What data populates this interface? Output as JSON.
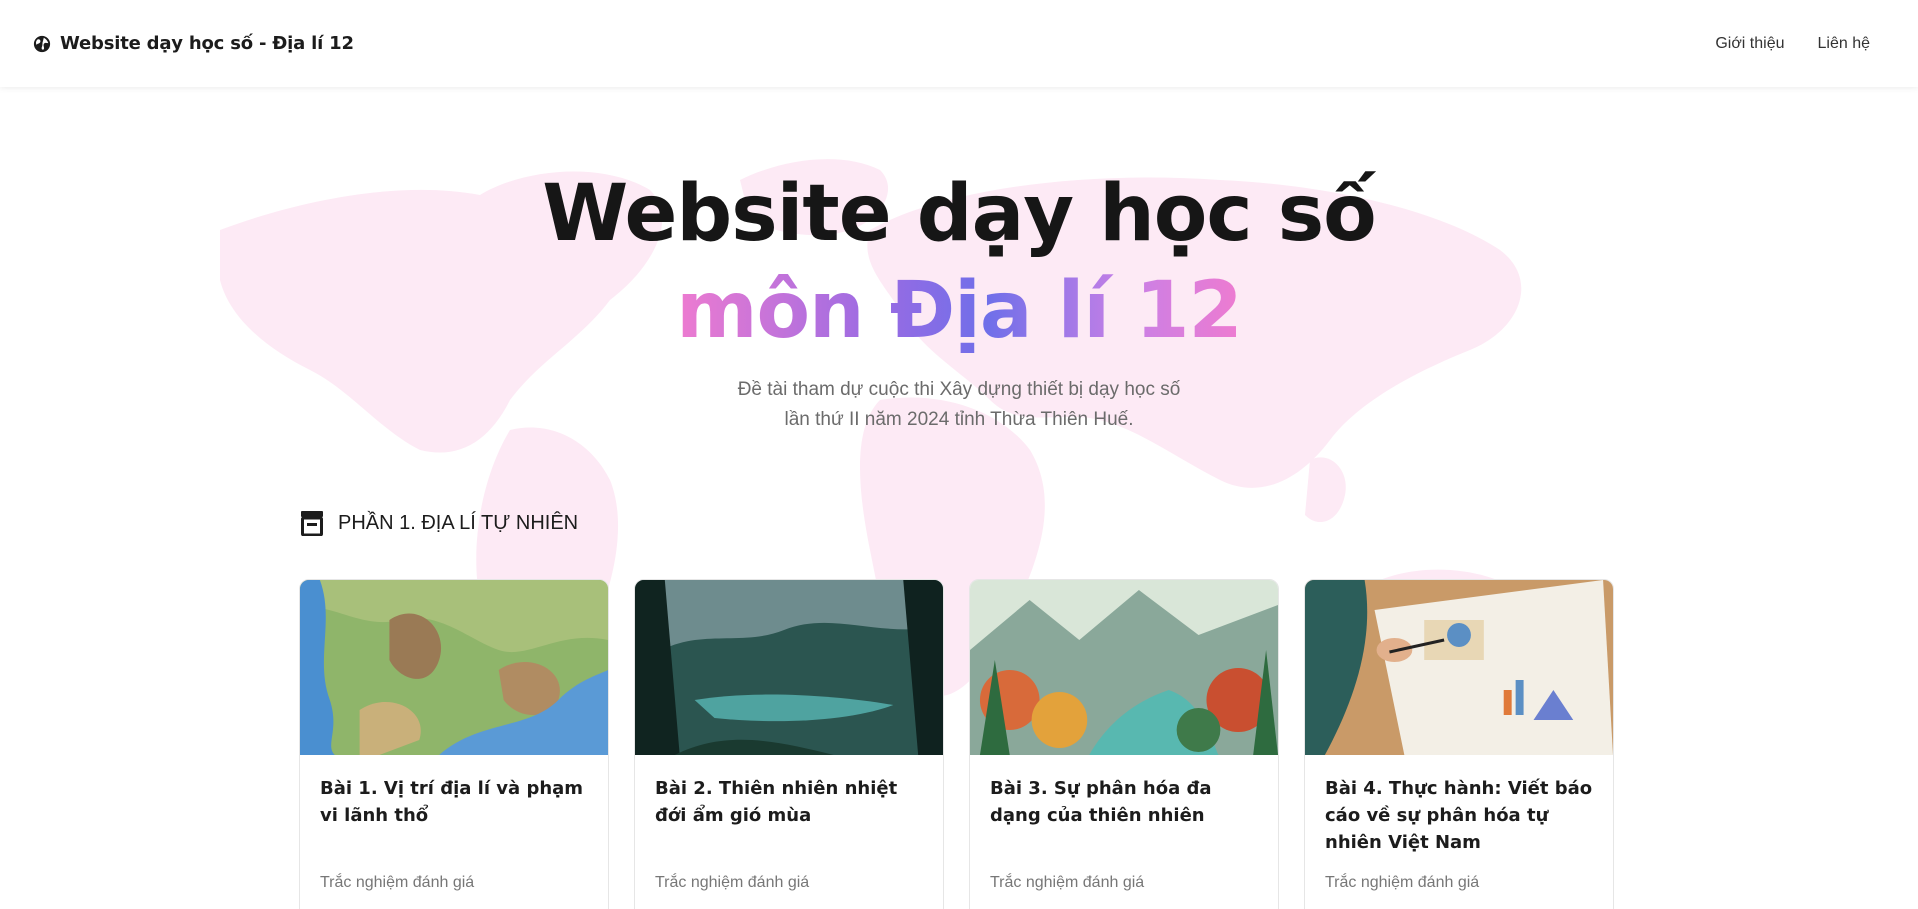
{
  "header": {
    "brand_title": "Website dạy học số - Địa lí 12",
    "nav": [
      {
        "label": "Giới thiệu"
      },
      {
        "label": "Liên hệ"
      }
    ]
  },
  "hero": {
    "line1": "Website dạy học số",
    "line2": "môn Địa lí 12",
    "subtitle_line1": "Đề tài tham dự cuộc thi Xây dựng thiết bị dạy học số",
    "subtitle_line2": "lần thứ II năm 2024 tỉnh Thừa Thiên Huế."
  },
  "section": {
    "title": "PHẦN 1. ĐỊA LÍ TỰ NHIÊN",
    "icon": "archive-box-icon"
  },
  "cards": [
    {
      "title": "Bài 1. Vị trí địa lí và phạm vi lãnh thổ",
      "link": "Trắc nghiệm đánh giá",
      "image": "topographic-map"
    },
    {
      "title": "Bài 2. Thiên nhiên nhiệt đới ẩm gió mùa",
      "link": "Trắc nghiệm đánh giá",
      "image": "tropical-rainforest-river"
    },
    {
      "title": "Bài 3. Sự phân hóa đa dạng của thiên nhiên",
      "link": "Trắc nghiệm đánh giá",
      "image": "colorful-forest-valley"
    },
    {
      "title": "Bài 4. Thực hành: Viết báo cáo về sự phân hóa tự nhiên Việt Nam",
      "link": "Trắc nghiệm đánh giá",
      "image": "person-writing-report"
    }
  ],
  "colors": {
    "gradient_pink": "#ee7bd0",
    "gradient_purple": "#9b6be3",
    "gradient_indigo": "#6f6fe9",
    "map_tint": "#fde8f4"
  }
}
